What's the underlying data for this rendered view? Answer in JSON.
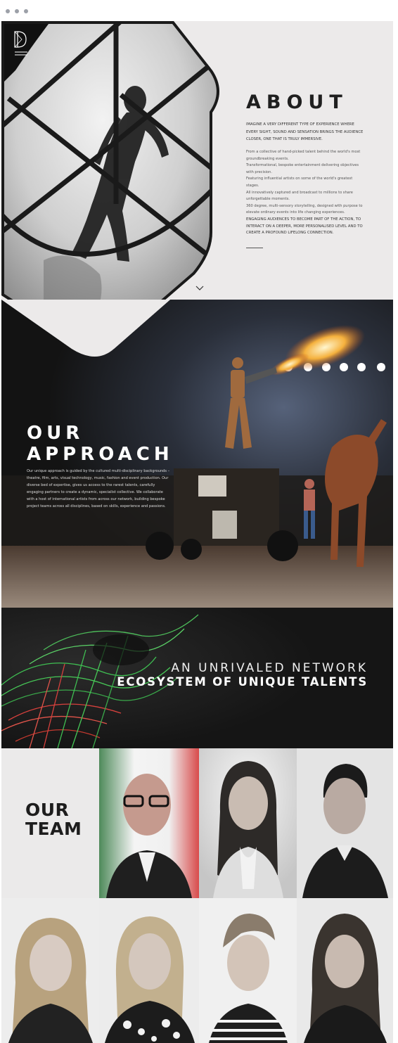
{
  "about": {
    "title": "ABOUT",
    "lead": "Imagine a very different type of experience where every sight, sound and sensation brings the audience closer, one that is truly immersive.",
    "body": [
      "From a collective of hand-picked talent behind the world's most groundbreaking events.",
      "Transformational, bespoke entertainment delivering objectives with precision.",
      "Featuring influential artists on some of the world's greatest stages.",
      "All innovatively captured and broadcast to millions to share unforgettable moments.",
      "360 degree, multi-sensory storytelling, designed with purpose to elevate ordinary events into life changing experiences."
    ],
    "tail": "Engaging audiences to become part of the action, to interact on a deeper, more personalised level and to create a profound lifelong connection."
  },
  "approach": {
    "title_line1": "OUR",
    "title_line2": "APPROACH",
    "text": "Our unique approach is guided by the cultured multi-disciplinary backgrounds – theatre, film, arts, visual technology, music, fashion and event production. Our diverse bed of expertise, gives us access to the rarest talents, carefully engaging partners to create a dynamic, specialist collective. We collaborate with a host of international artists from across our network, building bespoke project teams across all disciplines, based on skills, experience and passions."
  },
  "network": {
    "line1": "AN UNRIVALED NETWORK",
    "line2": "ECOSYSTEM OF UNIQUE TALENTS"
  },
  "team": {
    "title_line1": "OUR",
    "title_line2": "TEAM"
  },
  "colors": {
    "background": "#eceaea",
    "dark": "#1b1a1a",
    "flame": "#f3a63a",
    "laser_green": "#4fc94a",
    "laser_red": "#e0463f"
  }
}
